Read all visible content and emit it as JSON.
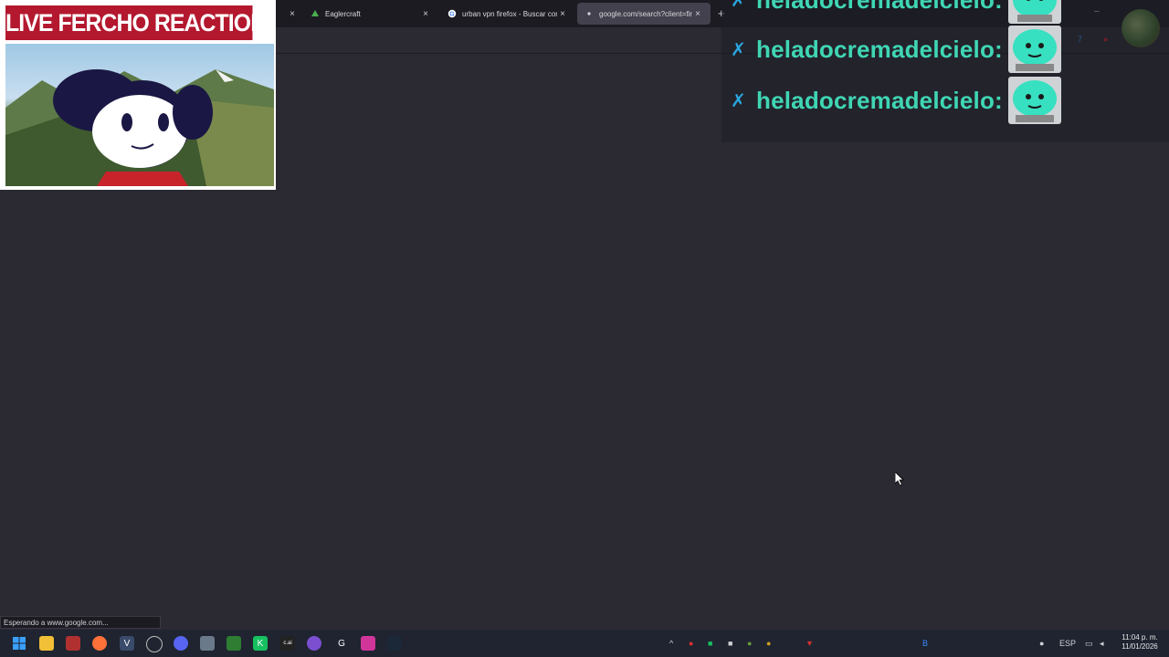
{
  "browser": {
    "tabs": [
      {
        "title": "Eaglercraft",
        "favicon": "eaglercraft-icon",
        "active": false
      },
      {
        "title": "urban vpn firefox - Buscar con G",
        "favicon": "google-icon",
        "active": false
      },
      {
        "title": "google.com/search?client=firef",
        "favicon": "loading-dot-icon",
        "active": true
      }
    ],
    "new_tab_label": "+",
    "close_glyph": "×",
    "window_controls": {
      "minimize": "–"
    }
  },
  "overlay": {
    "title": "LIVE FERCHO REACTION"
  },
  "chat": {
    "messages": [
      {
        "user": "heladocremadelcielo:",
        "badge": "sword-icon",
        "emote": "robot-emote"
      },
      {
        "user": "heladocremadelcielo:",
        "badge": "sword-icon",
        "emote": "robot-emote"
      },
      {
        "user": "heladocremadelcielo:",
        "badge": "sword-icon",
        "emote": "robot-emote"
      }
    ],
    "colors": {
      "username": "#3fd6b4",
      "badge": "#2aa7e0"
    }
  },
  "status_bar": {
    "text": "Esperando a www.google.com..."
  },
  "taskbar": {
    "language": "ESP",
    "time": "11:04 p. m.",
    "date": "11/01/2026"
  }
}
